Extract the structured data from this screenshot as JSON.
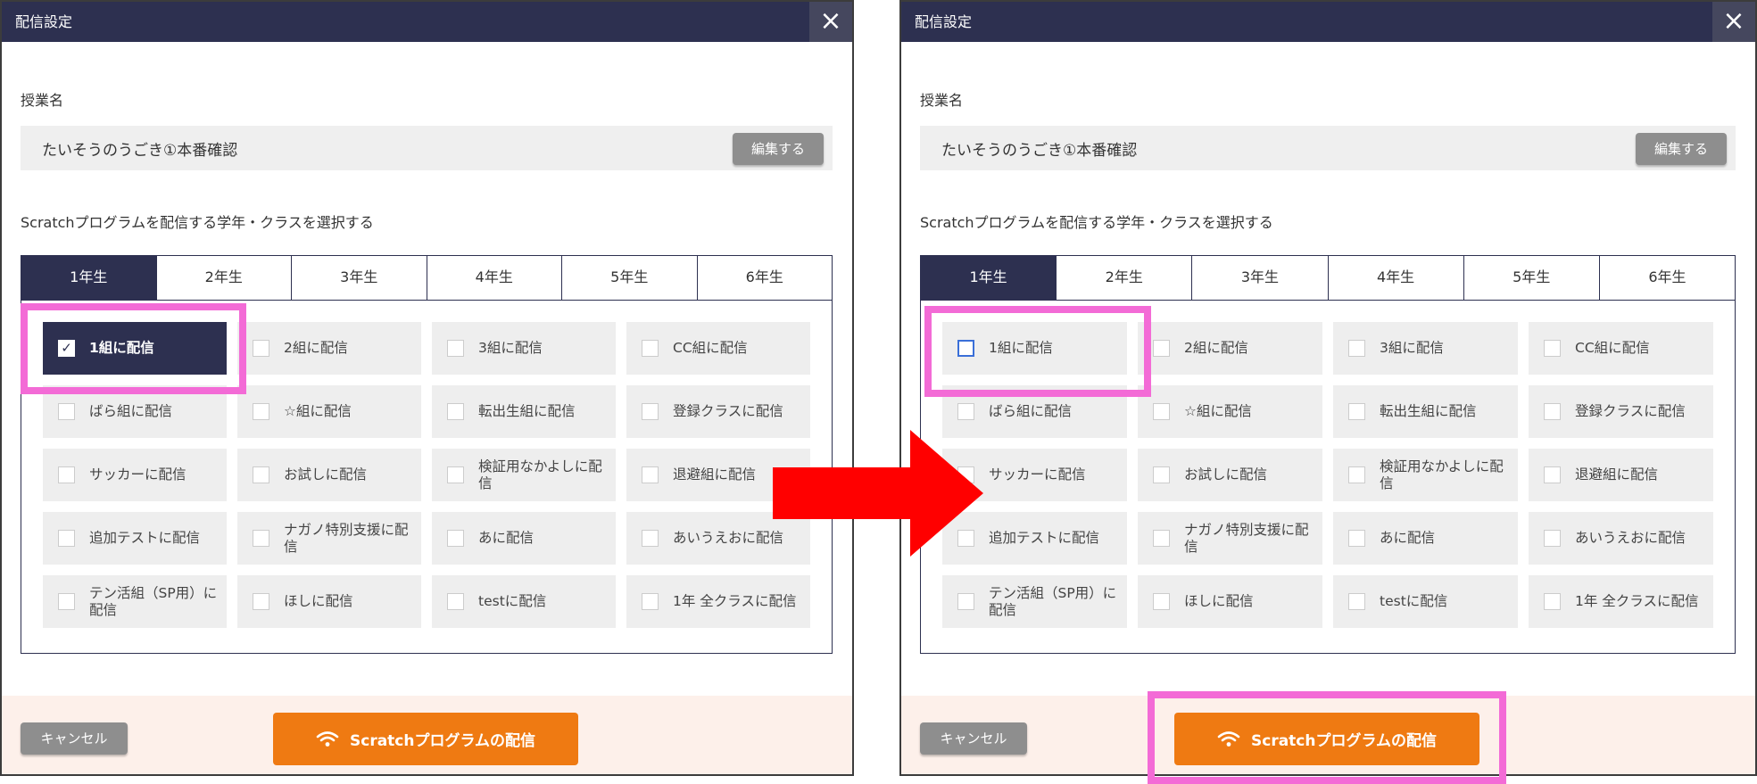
{
  "dialog_title": "配信設定",
  "close_icon": "×",
  "lesson_label": "授業名",
  "lesson_name": "たいそうのうごき①本番確認",
  "edit_button": "編集する",
  "select_label": "Scratchプログラムを配信する学年・クラスを選択する",
  "grade_tabs": [
    "1年生",
    "2年生",
    "3年生",
    "4年生",
    "5年生",
    "6年生"
  ],
  "active_grade": "1年生",
  "classes": [
    "1組に配信",
    "2組に配信",
    "3組に配信",
    "CC組に配信",
    "ばら組に配信",
    "☆組に配信",
    "転出生組に配信",
    "登録クラスに配信",
    "サッカーに配信",
    "お試しに配信",
    "検証用なかよしに配信",
    "退避組に配信",
    "追加テストに配信",
    "ナガノ特別支援に配信",
    "あに配信",
    "あいうえおに配信",
    "テン活組（SP用）に配信",
    "ほしに配信",
    "testに配信",
    "1年 全クラスに配信"
  ],
  "cancel_button": "キャンセル",
  "deliver_button": "Scratchプログラムの配信",
  "check_mark": "✓",
  "left_state": {
    "checked_class": "1組に配信"
  },
  "right_state": {
    "checked_class": "",
    "focused_class": "1組に配信"
  },
  "colors": {
    "navy": "#2d3050",
    "orange": "#ef7a12",
    "highlight": "#f36bd6",
    "arrow": "#ff0000",
    "footer": "#fdf0ea"
  },
  "icons": [
    "close-icon",
    "wifi-icon",
    "checkbox-icon",
    "right-arrow-icon"
  ]
}
